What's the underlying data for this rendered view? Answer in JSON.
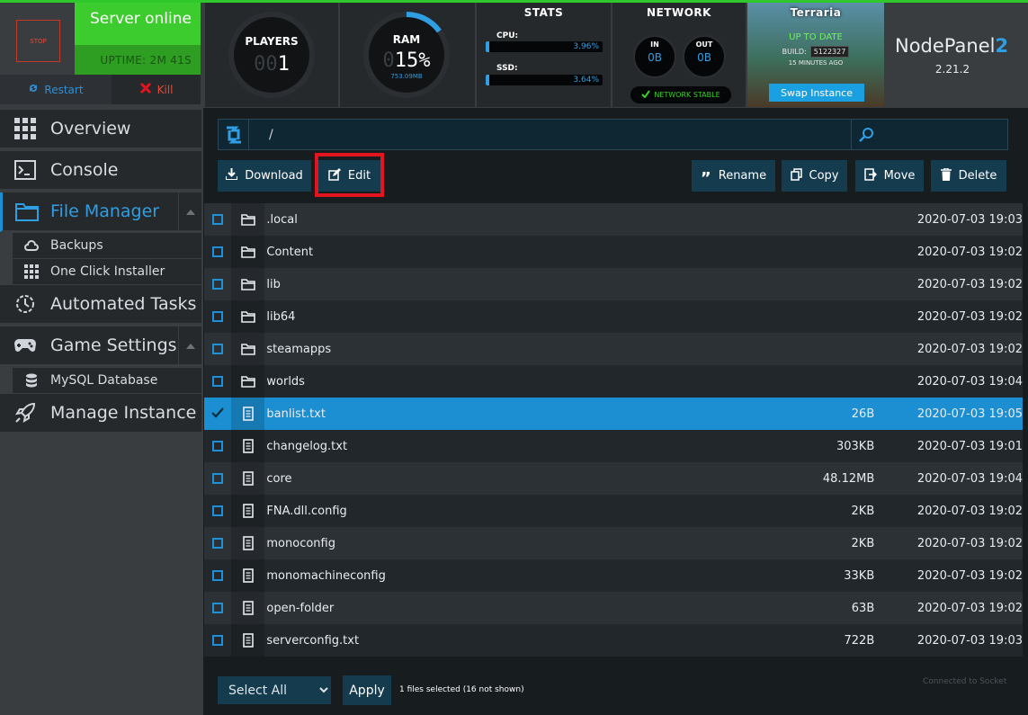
{
  "server": {
    "stop_label": "STOP",
    "status": "Server online",
    "uptime": "UPTIME: 2M 41S",
    "restart_label": "Restart",
    "kill_label": "Kill"
  },
  "players": {
    "label": "PLAYERS",
    "dim_digits": "00",
    "value": "1"
  },
  "ram": {
    "label": "RAM",
    "dim_digits": "0",
    "value": "15%",
    "used": "753.09MB",
    "percent": 15
  },
  "stats": {
    "title": "STATS",
    "cpu_label": "CPU:",
    "cpu_value": "3.96%",
    "ssd_label": "SSD:",
    "ssd_value": "3.64%"
  },
  "network": {
    "title": "NETWORK",
    "in_label": "IN",
    "in_value": "0B",
    "out_label": "OUT",
    "out_value": "0B",
    "status": "NETWORK STABLE"
  },
  "game": {
    "title": "Terraria",
    "update_status": "UP TO DATE",
    "build_label": "BUILD:",
    "build": "5122327",
    "updated_ago": "15 MINUTES AGO",
    "swap_label": "Swap Instance"
  },
  "brand": {
    "name": "NodePanel",
    "suffix": "2",
    "version": "2.21.2"
  },
  "sidebar": {
    "overview": "Overview",
    "console": "Console",
    "file_manager": "File Manager",
    "backups": "Backups",
    "one_click": "One Click Installer",
    "automated_tasks": "Automated Tasks",
    "game_settings": "Game Settings",
    "mysql": "MySQL Database",
    "manage_instance": "Manage Instance"
  },
  "toolbar": {
    "path": "/",
    "download": "Download",
    "edit": "Edit",
    "rename": "Rename",
    "copy": "Copy",
    "move": "Move",
    "delete": "Delete"
  },
  "files": [
    {
      "name": ".local",
      "type": "folder",
      "size": "",
      "date": "2020-07-03 19:03",
      "selected": false
    },
    {
      "name": "Content",
      "type": "folder",
      "size": "",
      "date": "2020-07-03 19:02",
      "selected": false
    },
    {
      "name": "lib",
      "type": "folder",
      "size": "",
      "date": "2020-07-03 19:02",
      "selected": false
    },
    {
      "name": "lib64",
      "type": "folder",
      "size": "",
      "date": "2020-07-03 19:02",
      "selected": false
    },
    {
      "name": "steamapps",
      "type": "folder",
      "size": "",
      "date": "2020-07-03 19:02",
      "selected": false
    },
    {
      "name": "worlds",
      "type": "folder",
      "size": "",
      "date": "2020-07-03 19:04",
      "selected": false
    },
    {
      "name": "banlist.txt",
      "type": "file",
      "size": "26B",
      "date": "2020-07-03 19:05",
      "selected": true
    },
    {
      "name": "changelog.txt",
      "type": "file",
      "size": "303KB",
      "date": "2020-07-03 19:01",
      "selected": false
    },
    {
      "name": "core",
      "type": "file",
      "size": "48.12MB",
      "date": "2020-07-03 19:04",
      "selected": false
    },
    {
      "name": "FNA.dll.config",
      "type": "file",
      "size": "2KB",
      "date": "2020-07-03 19:02",
      "selected": false
    },
    {
      "name": "monoconfig",
      "type": "file",
      "size": "2KB",
      "date": "2020-07-03 19:02",
      "selected": false
    },
    {
      "name": "monomachineconfig",
      "type": "file",
      "size": "33KB",
      "date": "2020-07-03 19:02",
      "selected": false
    },
    {
      "name": "open-folder",
      "type": "file",
      "size": "63B",
      "date": "2020-07-03 19:02",
      "selected": false
    },
    {
      "name": "serverconfig.txt",
      "type": "file",
      "size": "722B",
      "date": "2020-07-03 19:03",
      "selected": false
    }
  ],
  "footer": {
    "select_all": "Select All",
    "apply": "Apply",
    "selection_status": "1 files selected (16 not shown)",
    "socket_status": "Connected to Socket"
  },
  "colors": {
    "accent": "#1b8fd2",
    "online": "#3dcc2d",
    "danger": "#e2151f"
  }
}
